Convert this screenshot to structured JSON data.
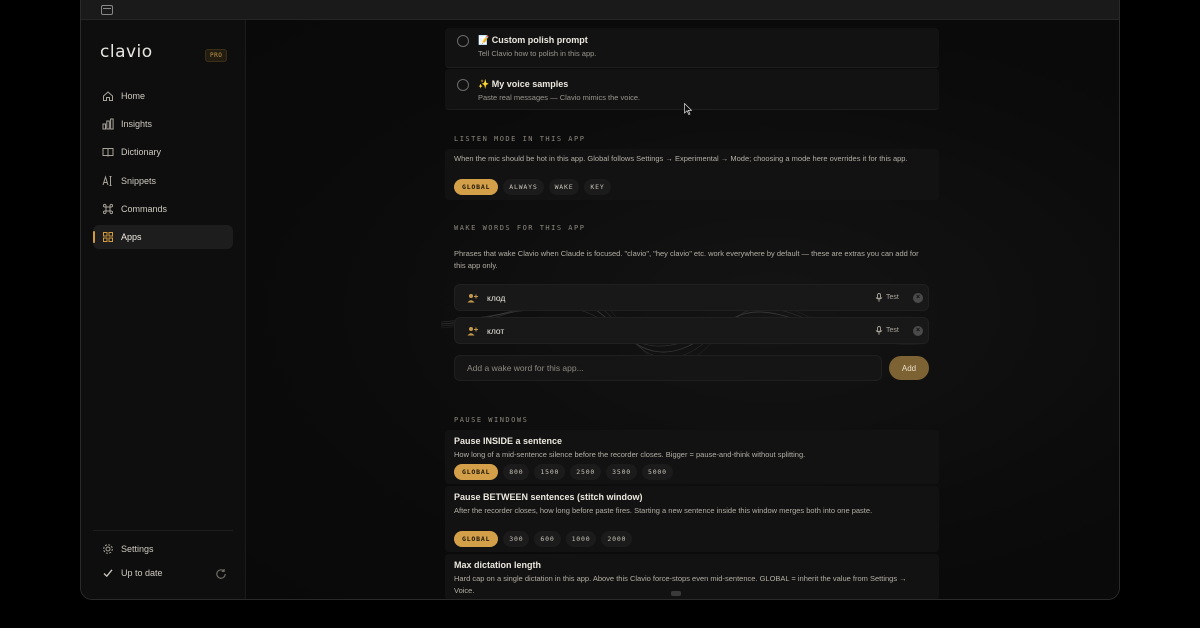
{
  "app": {
    "logo": "clavio",
    "badge": "PRO"
  },
  "sidebar": {
    "items": [
      {
        "label": "Home",
        "icon": "home-icon"
      },
      {
        "label": "Insights",
        "icon": "bar-chart-icon"
      },
      {
        "label": "Dictionary",
        "icon": "book-icon"
      },
      {
        "label": "Snippets",
        "icon": "text-cursor-icon"
      },
      {
        "label": "Commands",
        "icon": "command-icon"
      },
      {
        "label": "Apps",
        "icon": "grid-icon",
        "active": true
      }
    ],
    "bottom": {
      "settings": "Settings",
      "status": "Up to date"
    }
  },
  "cards": [
    {
      "emoji": "📝",
      "title": "Custom polish prompt",
      "desc": "Tell Clavio how to polish in this app."
    },
    {
      "emoji": "✨",
      "title": "My voice samples",
      "desc": "Paste real messages — Clavio mimics the voice."
    }
  ],
  "listen_mode": {
    "label": "LISTEN MODE IN THIS APP",
    "desc": "When the mic should be hot in this app. Global follows Settings → Experimental → Mode; choosing a mode here overrides it for this app.",
    "options": [
      "GLOBAL",
      "ALWAYS",
      "WAKE",
      "KEY"
    ],
    "selected": "GLOBAL"
  },
  "wake_words": {
    "label": "WAKE WORDS FOR THIS APP",
    "desc": "Phrases that wake Clavio when Claude is focused. \"clavio\", \"hey clavio\" etc. work everywhere by default — these are extras you can add for this app only.",
    "words": [
      "клод",
      "клот"
    ],
    "test_label": "Test",
    "input_placeholder": "Add a wake word for this app...",
    "add_label": "Add"
  },
  "pause_windows": {
    "label": "PAUSE WINDOWS",
    "inside": {
      "title": "Pause INSIDE a sentence",
      "desc": "How long of a mid-sentence silence before the recorder closes. Bigger = pause-and-think without splitting.",
      "options": [
        "GLOBAL",
        "800",
        "1500",
        "2500",
        "3500",
        "5000"
      ]
    },
    "between": {
      "title": "Pause BETWEEN sentences (stitch window)",
      "desc": "After the recorder closes, how long before paste fires. Starting a new sentence inside this window merges both into one paste.",
      "options": [
        "GLOBAL",
        "300",
        "600",
        "1000",
        "2000"
      ]
    },
    "max": {
      "title": "Max dictation length",
      "desc": "Hard cap on a single dictation in this app. Above this Clavio force-stops even mid-sentence. GLOBAL = inherit the value from Settings → Voice."
    }
  },
  "colors": {
    "accent": "#d3a049",
    "background": "#0c0c0c",
    "active_nav": "#1d1d1d"
  }
}
